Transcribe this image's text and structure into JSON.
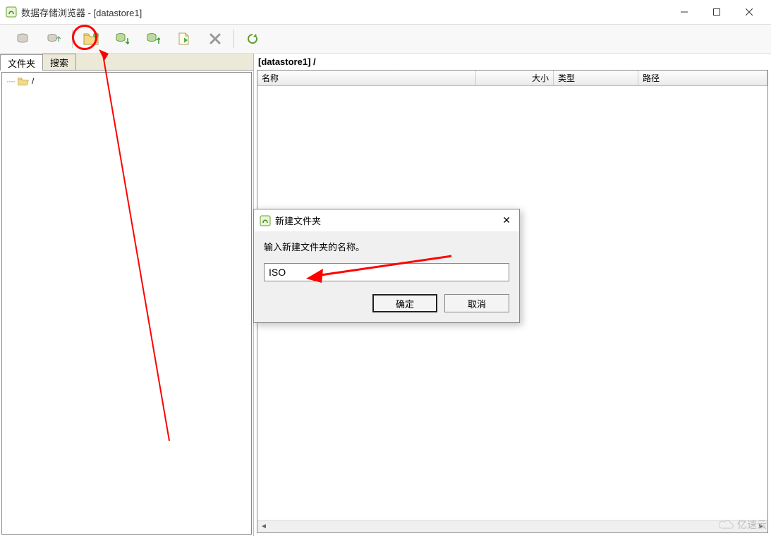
{
  "window": {
    "title": "数据存储浏览器 - [datastore1]"
  },
  "toolbar": {
    "items": [
      {
        "name": "datastore-info-icon"
      },
      {
        "name": "up-level-icon"
      },
      {
        "name": "new-folder-icon",
        "highlighted": true
      },
      {
        "name": "upload-folder-icon"
      },
      {
        "name": "download-folder-icon"
      },
      {
        "name": "upload-file-icon"
      },
      {
        "name": "delete-icon"
      },
      {
        "name": "refresh-icon"
      }
    ]
  },
  "tabs": {
    "items": [
      {
        "label": "文件夹",
        "active": true
      },
      {
        "label": "搜索",
        "active": false
      }
    ]
  },
  "tree": {
    "root_label": "/"
  },
  "content": {
    "path_label": "[datastore1] /",
    "columns": {
      "name": "名称",
      "size": "大小",
      "type": "类型",
      "path": "路径"
    }
  },
  "dialog": {
    "title": "新建文件夹",
    "message": "输入新建文件夹的名称。",
    "input_value": "ISO",
    "ok_label": "确定",
    "cancel_label": "取消"
  },
  "watermark": {
    "text": "亿速云"
  }
}
